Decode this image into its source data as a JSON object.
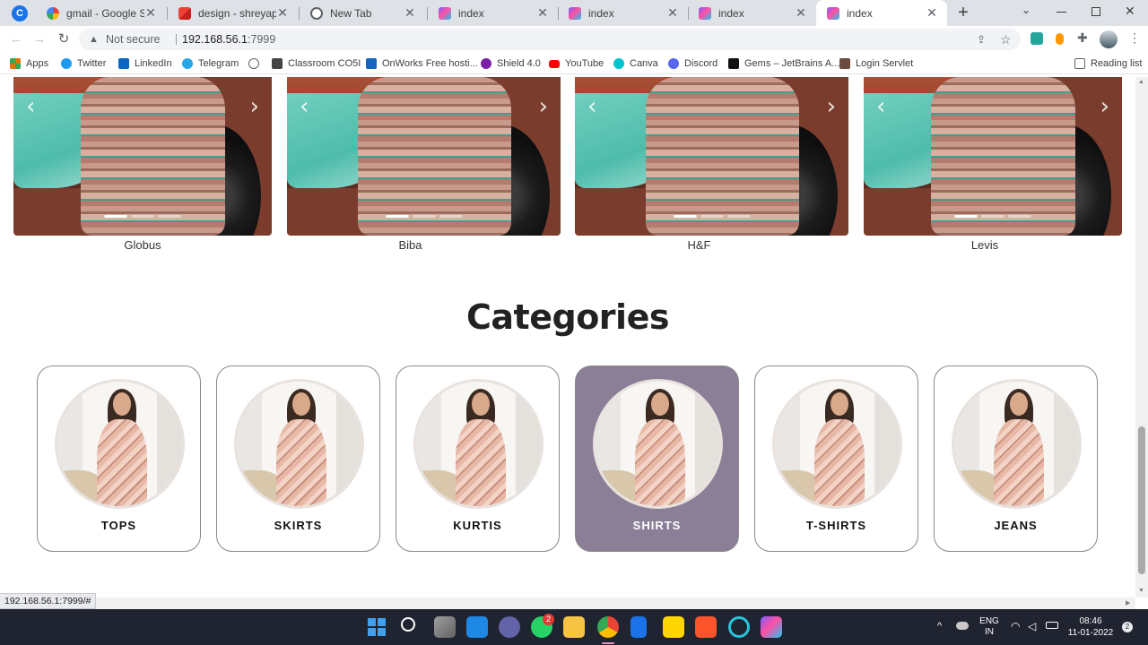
{
  "browser": {
    "tabs": [
      {
        "title": "gmail - Google Search",
        "icon": "google-icon",
        "active": false
      },
      {
        "title": "design - shreyaparas",
        "icon": "gmail-icon",
        "active": false
      },
      {
        "title": "New Tab",
        "icon": "chrome-icon",
        "active": false
      },
      {
        "title": "index",
        "icon": "app-icon",
        "active": false
      },
      {
        "title": "index",
        "icon": "app-icon",
        "active": false
      },
      {
        "title": "index",
        "icon": "app-icon",
        "active": false
      },
      {
        "title": "index",
        "icon": "app-icon",
        "active": true
      }
    ],
    "new_tab": "+",
    "security_label": "Not secure",
    "url_host": "192.168.56.1",
    "url_rest": ":7999",
    "bookmarks": [
      {
        "label": "Apps",
        "icon": "apps-grid-icon",
        "color": "#e37400"
      },
      {
        "label": "Twitter",
        "icon": "twitter-icon",
        "color": "#1d9bf0"
      },
      {
        "label": "LinkedIn",
        "icon": "linkedin-icon",
        "color": "#0a66c2"
      },
      {
        "label": "Telegram",
        "icon": "telegram-icon",
        "color": "#27a7e7"
      },
      {
        "label": "",
        "icon": "globe-icon",
        "color": "#5f6368"
      },
      {
        "label": "Classroom CO5I",
        "icon": "classroom-icon",
        "color": "#444444"
      },
      {
        "label": "OnWorks Free hosti...",
        "icon": "onworks-icon",
        "color": "#1565c0"
      },
      {
        "label": "Shield 4.0",
        "icon": "shield-icon",
        "color": "#7b1fa2"
      },
      {
        "label": "YouTube",
        "icon": "youtube-icon",
        "color": "#ff0000"
      },
      {
        "label": "Canva",
        "icon": "canva-icon",
        "color": "#00c4cc"
      },
      {
        "label": "Discord",
        "icon": "discord-icon",
        "color": "#5865f2"
      },
      {
        "label": "Gems – JetBrains A...",
        "icon": "jetbrains-icon",
        "color": "#111111"
      },
      {
        "label": "Login Servlet",
        "icon": "servlet-icon",
        "color": "#6d4c41"
      }
    ],
    "reading_list": "Reading list",
    "status_url": "192.168.56.1:7999/#"
  },
  "brands": [
    {
      "name": "Globus"
    },
    {
      "name": "Biba"
    },
    {
      "name": "H&F"
    },
    {
      "name": "Levis"
    }
  ],
  "categories": {
    "title": "Categories",
    "items": [
      {
        "label": "TOPS",
        "active": false
      },
      {
        "label": "SKIRTS",
        "active": false
      },
      {
        "label": "KURTIS",
        "active": false
      },
      {
        "label": "SHIRTS",
        "active": true
      },
      {
        "label": "T-SHIRTS",
        "active": false
      },
      {
        "label": "JEANS",
        "active": false
      }
    ],
    "active_color": "#8b7f98"
  },
  "taskbar": {
    "whatsapp_badge": "2",
    "language": "ENG",
    "region": "IN",
    "time": "08:46",
    "date": "11-01-2022",
    "notification_count": "2"
  }
}
